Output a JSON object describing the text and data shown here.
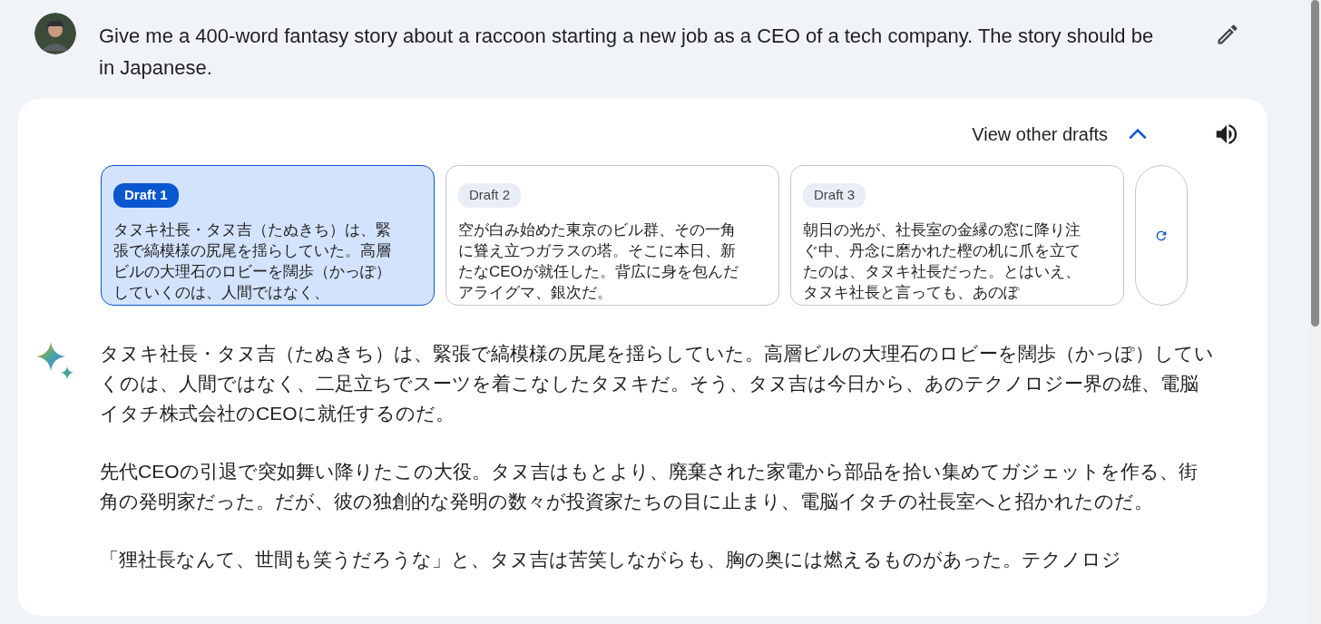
{
  "prompt": {
    "text": "Give me a 400-word fantasy story about a raccoon starting a new job as a CEO of a tech company. The story should be in Japanese."
  },
  "drafts_header": {
    "label": "View other drafts",
    "expanded": true
  },
  "drafts": [
    {
      "label": "Draft 1",
      "selected": true,
      "snippet": "タヌキ社長・タヌ吉（たぬきち）は、緊張で縞模様の尻尾を揺らしていた。高層ビルの大理石のロビーを闊歩（かっぽ）していくのは、人間ではなく、"
    },
    {
      "label": "Draft 2",
      "selected": false,
      "snippet": "空が白み始めた東京のビル群、その一角に聳え立つガラスの塔。そこに本日、新たなCEOが就任した。背広に身を包んだアライグマ、銀次だ。"
    },
    {
      "label": "Draft 3",
      "selected": false,
      "snippet": "朝日の光が、社長室の金縁の窓に降り注ぐ中、丹念に磨かれた樫の机に爪を立てたのは、タヌキ社長だった。とはいえ、タヌキ社長と言っても、あのぽ"
    }
  ],
  "response": {
    "paragraphs": [
      "タヌキ社長・タヌ吉（たぬきち）は、緊張で縞模様の尻尾を揺らしていた。高層ビルの大理石のロビーを闊歩（かっぽ）していくのは、人間ではなく、二足立ちでスーツを着こなしたタヌキだ。そう、タヌ吉は今日から、あのテクノロジー界の雄、電脳イタチ株式会社のCEOに就任するのだ。",
      "先代CEOの引退で突如舞い降りたこの大役。タヌ吉はもとより、廃棄された家電から部品を拾い集めてガジェットを作る、街角の発明家だった。だが、彼の独創的な発明の数々が投資家たちの目に止まり、電脳イタチの社長室へと招かれたのだ。",
      "「狸社長なんて、世間も笑うだろうな」と、タヌ吉は苦笑しながらも、胸の奥には燃えるものがあった。テクノロジ"
    ]
  }
}
